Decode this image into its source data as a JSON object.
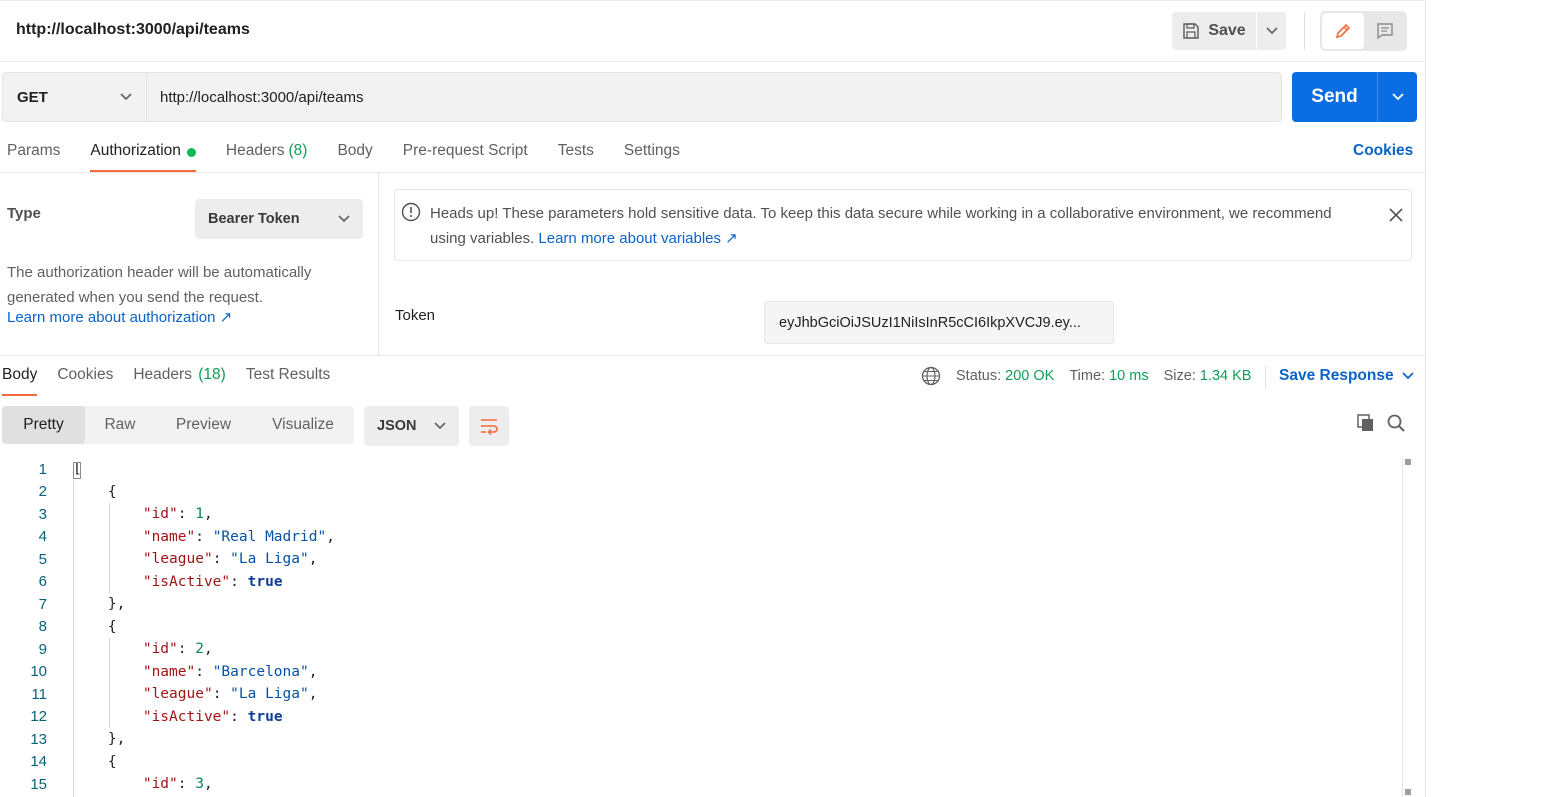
{
  "header": {
    "title": "http://localhost:3000/api/teams",
    "save_label": "Save"
  },
  "request": {
    "method": "GET",
    "url": "http://localhost:3000/api/teams",
    "send_label": "Send"
  },
  "request_tabs": {
    "params": "Params",
    "authorization": "Authorization",
    "headers": "Headers",
    "headers_count": "(8)",
    "body": "Body",
    "prerequest": "Pre-request Script",
    "tests": "Tests",
    "settings": "Settings",
    "cookies": "Cookies"
  },
  "auth": {
    "type_label": "Type",
    "type_value": "Bearer Token",
    "description": "The authorization header will be automatically generated when you send the request.",
    "learn_more": "Learn more about authorization ↗",
    "alert_text": "Heads up! These parameters hold sensitive data. To keep this data secure while working in a collaborative environment, we recommend using variables.",
    "alert_link": "Learn more about variables ↗",
    "token_label": "Token",
    "token_value": "eyJhbGciOiJSUzI1NiIsInR5cCI6IkpXVCJ9.ey..."
  },
  "response_tabs": {
    "body": "Body",
    "cookies": "Cookies",
    "headers": "Headers",
    "headers_count": "(18)",
    "test_results": "Test Results"
  },
  "response_meta": {
    "status_label": "Status:",
    "status_value": "200 OK",
    "time_label": "Time:",
    "time_value": "10 ms",
    "size_label": "Size:",
    "size_value": "1.34 KB",
    "save_response": "Save Response"
  },
  "view": {
    "modes": [
      "Pretty",
      "Raw",
      "Preview",
      "Visualize"
    ],
    "active_mode": "Pretty",
    "format": "JSON"
  },
  "code_lines": [
    {
      "n": "1"
    },
    {
      "n": "2"
    },
    {
      "n": "3"
    },
    {
      "n": "4"
    },
    {
      "n": "5"
    },
    {
      "n": "6"
    },
    {
      "n": "7"
    },
    {
      "n": "8"
    },
    {
      "n": "9"
    },
    {
      "n": "10"
    },
    {
      "n": "11"
    },
    {
      "n": "12"
    },
    {
      "n": "13"
    },
    {
      "n": "14"
    },
    {
      "n": "15"
    }
  ],
  "json_body": {
    "teams": [
      {
        "id": "1",
        "name": "\"Real Madrid\"",
        "league": "\"La Liga\"",
        "isActive": "true"
      },
      {
        "id": "2",
        "name": "\"Barcelona\"",
        "league": "\"La Liga\"",
        "isActive": "true"
      },
      {
        "id": "3"
      }
    ],
    "keys": {
      "id": "\"id\"",
      "name": "\"name\"",
      "league": "\"league\"",
      "isActive": "\"isActive\""
    }
  },
  "colors": {
    "accent_orange": "#f26b3a",
    "send_blue": "#0a6ee2",
    "link_blue": "#0b63c8",
    "status_green": "#0f9d58"
  }
}
